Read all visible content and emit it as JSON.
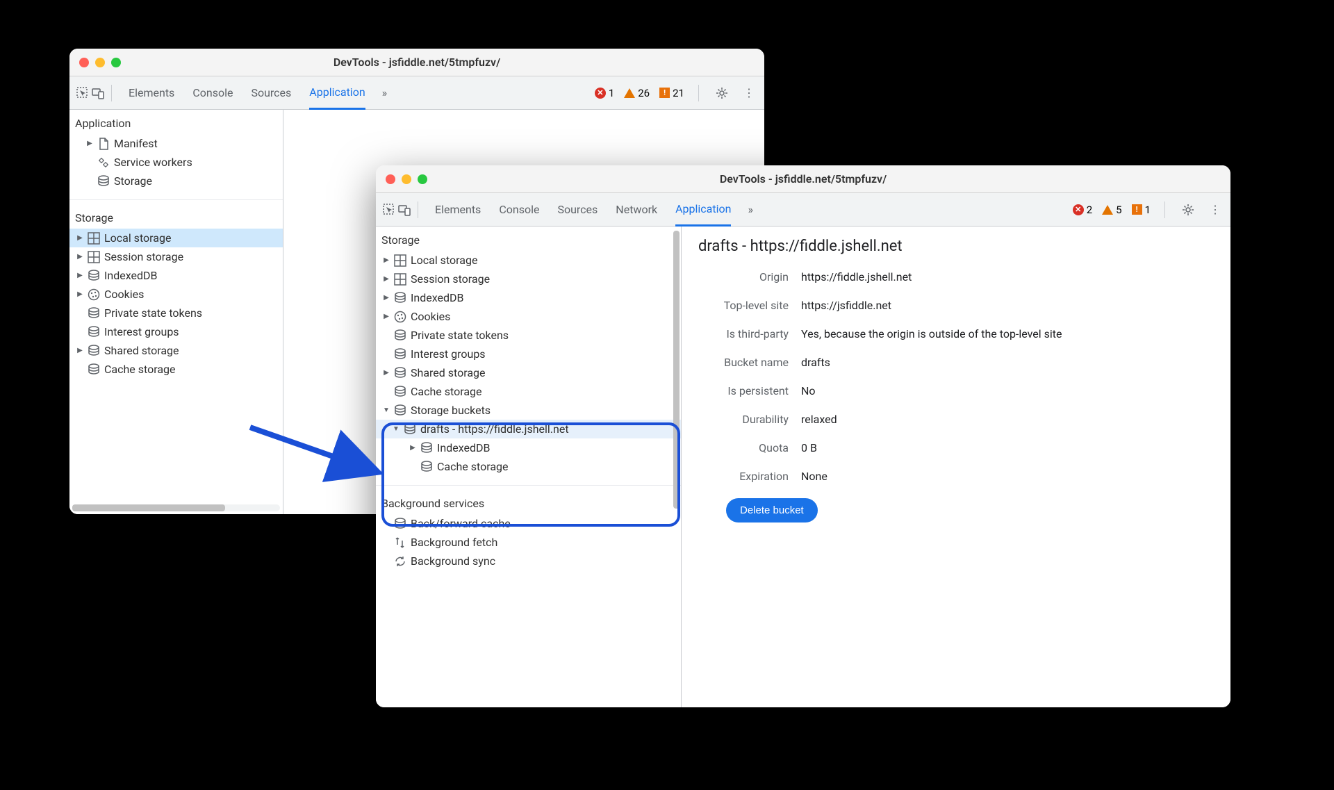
{
  "window1": {
    "title": "DevTools - jsfiddle.net/5tmpfuzv/",
    "tabs": [
      "Elements",
      "Console",
      "Sources",
      "Application"
    ],
    "activeTab": "Application",
    "errors": "1",
    "warnings": "26",
    "issues": "21",
    "sidebar": {
      "sec1": "Application",
      "manifest": "Manifest",
      "sw": "Service workers",
      "storage": "Storage",
      "sec2": "Storage",
      "local": "Local storage",
      "session": "Session storage",
      "idb": "IndexedDB",
      "cookies": "Cookies",
      "pst": "Private state tokens",
      "ig": "Interest groups",
      "shared": "Shared storage",
      "cache": "Cache storage"
    }
  },
  "window2": {
    "title": "DevTools - jsfiddle.net/5tmpfuzv/",
    "tabs": [
      "Elements",
      "Console",
      "Sources",
      "Network",
      "Application"
    ],
    "activeTab": "Application",
    "errors": "2",
    "warnings": "5",
    "issues": "1",
    "sidebar": {
      "sec_storage": "Storage",
      "local": "Local storage",
      "session": "Session storage",
      "idb": "IndexedDB",
      "cookies": "Cookies",
      "pst": "Private state tokens",
      "ig": "Interest groups",
      "shared": "Shared storage",
      "cache": "Cache storage",
      "buckets": "Storage buckets",
      "drafts": "drafts - https://fiddle.jshell.net",
      "bidb": "IndexedDB",
      "bcache": "Cache storage",
      "sec_bg": "Background services",
      "bfc": "Back/forward cache",
      "bf": "Background fetch",
      "bs": "Background sync"
    },
    "detail": {
      "title": "drafts - https://fiddle.jshell.net",
      "rows": {
        "origin_l": "Origin",
        "origin_v": "https://fiddle.jshell.net",
        "tls_l": "Top-level site",
        "tls_v": "https://jsfiddle.net",
        "tp_l": "Is third-party",
        "tp_v": "Yes, because the origin is outside of the top-level site",
        "bn_l": "Bucket name",
        "bn_v": "drafts",
        "pers_l": "Is persistent",
        "pers_v": "No",
        "dur_l": "Durability",
        "dur_v": "relaxed",
        "quota_l": "Quota",
        "quota_v": "0 B",
        "exp_l": "Expiration",
        "exp_v": "None"
      },
      "delete": "Delete bucket"
    }
  }
}
